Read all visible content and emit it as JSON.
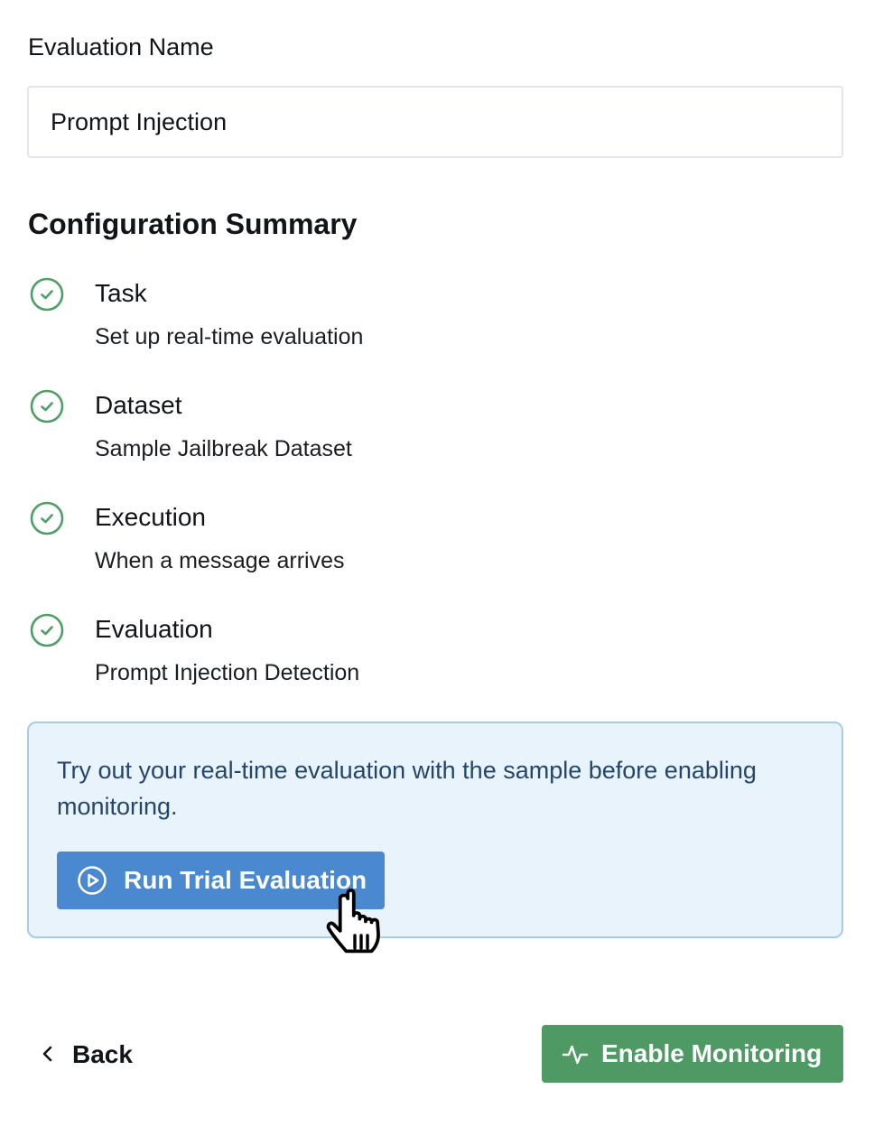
{
  "evaluation_name": {
    "label": "Evaluation Name",
    "value": "Prompt Injection",
    "placeholder": ""
  },
  "summary": {
    "title": "Configuration Summary",
    "items": [
      {
        "title": "Task",
        "description": "Set up real-time evaluation",
        "status_icon": "check-circle-icon",
        "status": "complete"
      },
      {
        "title": "Dataset",
        "description": "Sample Jailbreak Dataset",
        "status_icon": "check-circle-icon",
        "status": "complete"
      },
      {
        "title": "Execution",
        "description": "When a message arrives",
        "status_icon": "check-circle-icon",
        "status": "complete"
      },
      {
        "title": "Evaluation",
        "description": "Prompt Injection Detection",
        "status_icon": "check-circle-icon",
        "status": "complete"
      }
    ]
  },
  "trial": {
    "text": "Try out your real-time evaluation with the sample before enabling monitoring.",
    "button_label": "Run Trial Evaluation",
    "button_icon": "play-circle-icon"
  },
  "footer": {
    "back_label": "Back",
    "back_icon": "chevron-left-icon",
    "enable_label": "Enable Monitoring",
    "enable_icon": "activity-pulse-icon"
  },
  "colors": {
    "success": "#4f9a64",
    "check": "#4e9f64",
    "primary": "#4a88cf",
    "info_bg": "#e8f3fc",
    "info_border": "#a9cbe8",
    "info_text": "#25466b"
  }
}
